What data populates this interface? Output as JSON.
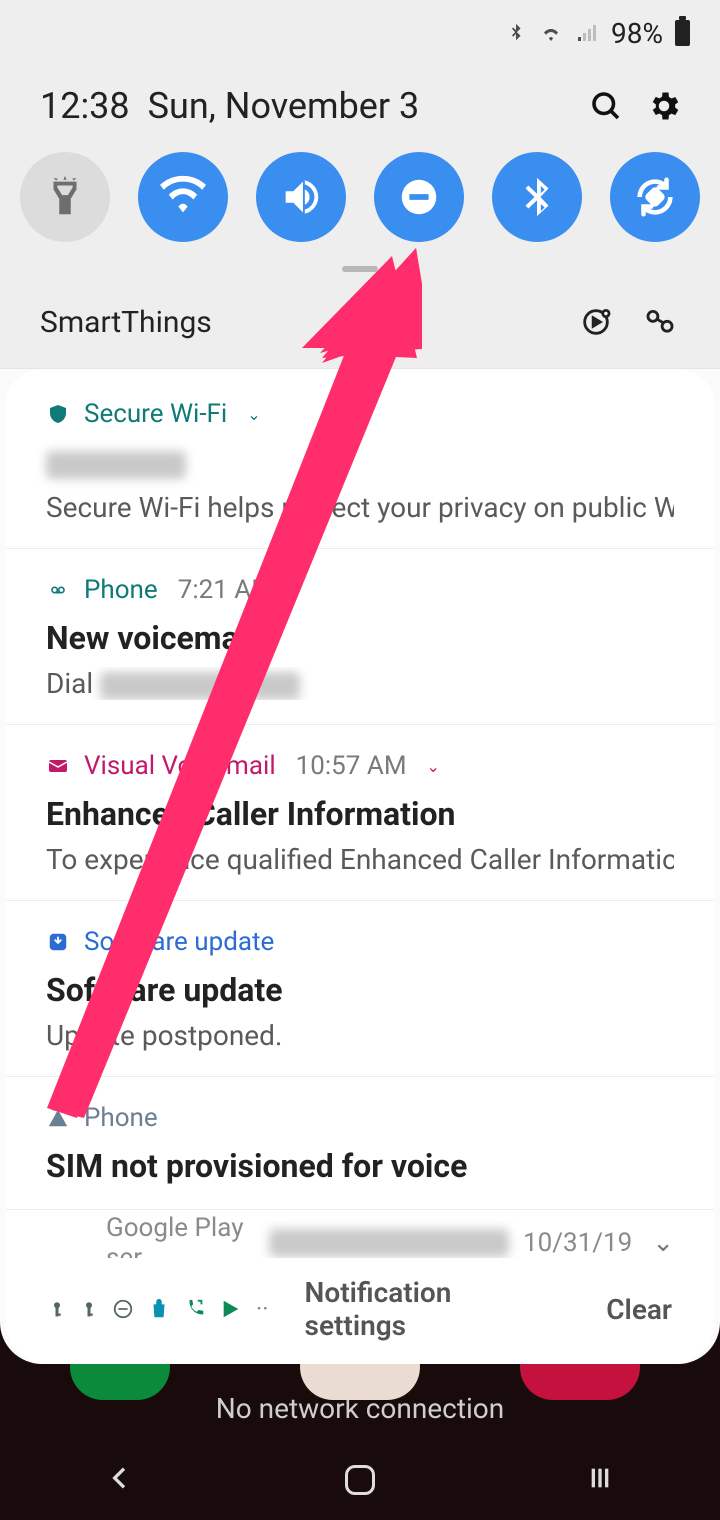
{
  "status": {
    "battery_text": "98%"
  },
  "header": {
    "time": "12:38",
    "date": "Sun, November 3"
  },
  "quick_toggles": [
    {
      "name": "flashlight",
      "active": false
    },
    {
      "name": "wifi",
      "active": true
    },
    {
      "name": "sound",
      "active": true
    },
    {
      "name": "dnd",
      "active": true
    },
    {
      "name": "bluetooth",
      "active": true
    },
    {
      "name": "rotate",
      "active": true
    }
  ],
  "smartthings": {
    "label": "SmartThings"
  },
  "notifications": [
    {
      "app": "Secure Wi-Fi",
      "app_color": "teal",
      "time": "",
      "chevron": true,
      "title_redacted": true,
      "text": "Secure Wi-Fi helps protect your privacy on public Wi-Fi n.."
    },
    {
      "app": "Phone",
      "app_color": "teal",
      "time": "7:21 AM",
      "chevron": false,
      "title": "New voicemail",
      "text_prefix": "Dial ",
      "text_redacted": true
    },
    {
      "app": "Visual Voicemail",
      "app_color": "magenta",
      "time": "10:57 AM",
      "chevron": true,
      "title": "Enhanced Caller Information",
      "text": "To experience qualified Enhanced Caller Information ena.."
    },
    {
      "app": "Software update",
      "app_color": "blue",
      "time": "",
      "chevron": false,
      "title": "Software update",
      "text": "Update postponed."
    },
    {
      "app": "Phone",
      "app_color": "grey",
      "time": "",
      "chevron": false,
      "title": "SIM not provisioned for voice",
      "text": ""
    }
  ],
  "partial": {
    "app": "Google Play ser",
    "date": "10/31/19"
  },
  "footer": {
    "settings_label": "Notification settings",
    "clear_label": "Clear"
  },
  "below": {
    "text": "No network connection"
  },
  "annotation": {
    "arrow_target": "dnd-toggle"
  }
}
